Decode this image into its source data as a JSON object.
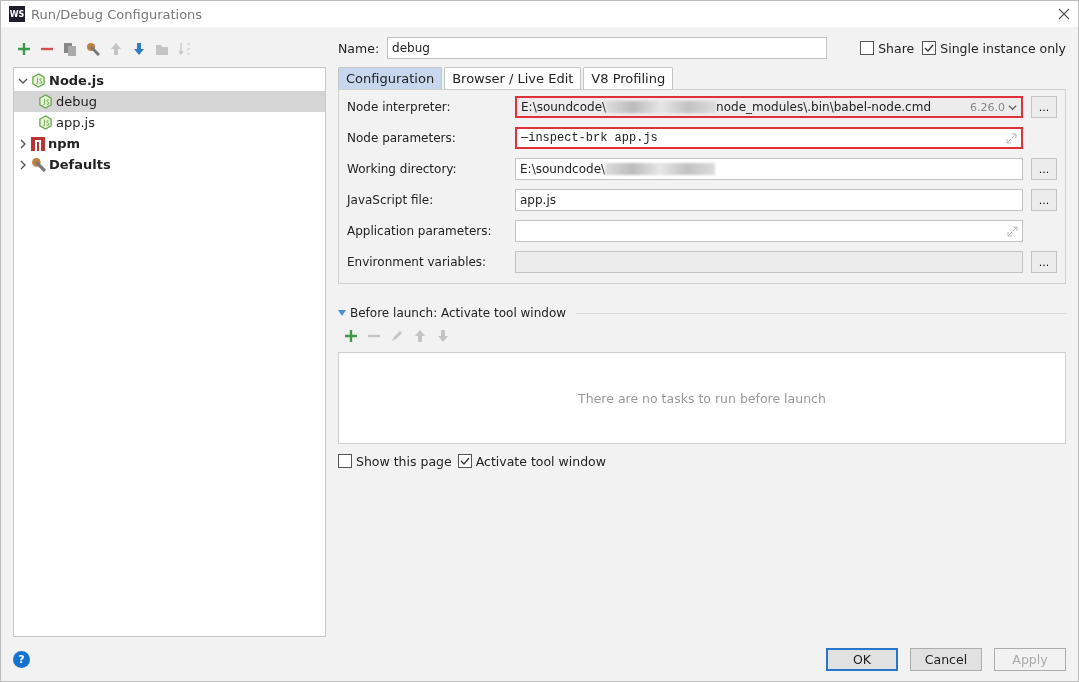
{
  "window": {
    "title": "Run/Debug Configurations",
    "app_badge": "WS"
  },
  "toolbar": [
    {
      "kind": "plus",
      "disabled": false
    },
    {
      "kind": "minus",
      "disabled": false
    },
    {
      "kind": "copy",
      "disabled": false
    },
    {
      "kind": "wrench",
      "disabled": false
    },
    {
      "kind": "up",
      "disabled": true
    },
    {
      "kind": "down",
      "disabled": false
    },
    {
      "kind": "folder",
      "disabled": true
    },
    {
      "kind": "sort",
      "disabled": true
    }
  ],
  "tree": [
    {
      "label": "Node.js",
      "kind": "node",
      "expanded": true,
      "selected": false,
      "children": [
        {
          "label": "debug",
          "kind": "node",
          "selected": true
        },
        {
          "label": "app.js",
          "kind": "node",
          "selected": false
        }
      ]
    },
    {
      "label": "npm",
      "kind": "npm",
      "expanded": false,
      "selected": false
    },
    {
      "label": "Defaults",
      "kind": "wrench",
      "expanded": false,
      "selected": false
    }
  ],
  "name_field": {
    "label": "Name:",
    "value": "debug"
  },
  "options": [
    {
      "label": "Share",
      "checked": false
    },
    {
      "label": "Single instance only",
      "checked": true
    }
  ],
  "tabs": [
    {
      "label": "Configuration",
      "selected": true
    },
    {
      "label": "Browser / Live Edit",
      "selected": false
    },
    {
      "label": "V8 Profiling",
      "selected": false
    }
  ],
  "fields": [
    {
      "label": "Node interpreter:",
      "kind": "combo",
      "value": "E:\\soundcode\\",
      "value_tail": "node_modules\\.bin\\babel-node.cmd",
      "version": "6.26.0",
      "browse_button": "...",
      "highlighted": true
    },
    {
      "label": "Node parameters:",
      "kind": "code",
      "value": "—inspect-brk app.js",
      "highlighted": true
    },
    {
      "label": "Working directory:",
      "kind": "path",
      "value": "E:\\soundcode\\",
      "browse_button": "...",
      "highlighted": false
    },
    {
      "label": "JavaScript file:",
      "kind": "text",
      "value": "app.js",
      "browse_button": "...",
      "highlighted": false
    },
    {
      "label": "Application parameters:",
      "kind": "expand",
      "highlighted": false
    },
    {
      "label": "Environment variables:",
      "kind": "disabled",
      "browse_button": "..."
    }
  ],
  "before_launch": {
    "title": "Before launch: Activate tool window",
    "expanded": true,
    "toolbar": [
      {
        "kind": "plus",
        "disabled": false
      },
      {
        "kind": "minus",
        "disabled": true
      },
      {
        "kind": "pencil",
        "disabled": true
      },
      {
        "kind": "up",
        "disabled": true
      },
      {
        "kind": "down",
        "disabled": true
      }
    ],
    "empty_text": "There are no tasks to run before launch",
    "options": [
      {
        "label": "Show this page",
        "checked": false
      },
      {
        "label": "Activate tool window",
        "checked": true
      }
    ]
  },
  "help": "?",
  "buttons": [
    {
      "label": "OK",
      "default": true,
      "disabled": false
    },
    {
      "label": "Cancel",
      "default": false,
      "disabled": false
    },
    {
      "label": "Apply",
      "default": false,
      "disabled": true
    }
  ]
}
